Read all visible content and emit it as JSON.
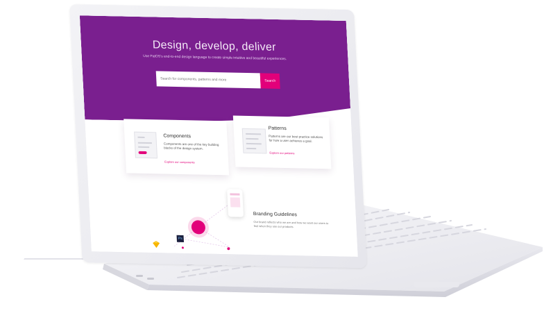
{
  "hero": {
    "title": "Design, develop, deliver",
    "subtitle": "Use PatOS's end-to-end design language to create simple intuitive and beautiful experiences.",
    "search_placeholder": "Search for components, patterns and more",
    "search_button": "Search"
  },
  "cards": {
    "components": {
      "title": "Components",
      "text": "Components are one of the key building blocks of the design system.",
      "link": "Explore our components"
    },
    "patterns": {
      "title": "Patterns",
      "text": "Patterns are our best practice solutions for how a user achieves a goal.",
      "link": "Explore our patterns"
    }
  },
  "branding": {
    "title": "Branding Guidelines",
    "text": "Our brand reflects who we are and how we want our users to feel when they use our products."
  },
  "icons": {
    "photoshop": "Ps",
    "sketch": "sketch-icon",
    "logo": "logo-icon"
  },
  "colors": {
    "brand_purple": "#7a1f8f",
    "accent_magenta": "#e2007a"
  }
}
